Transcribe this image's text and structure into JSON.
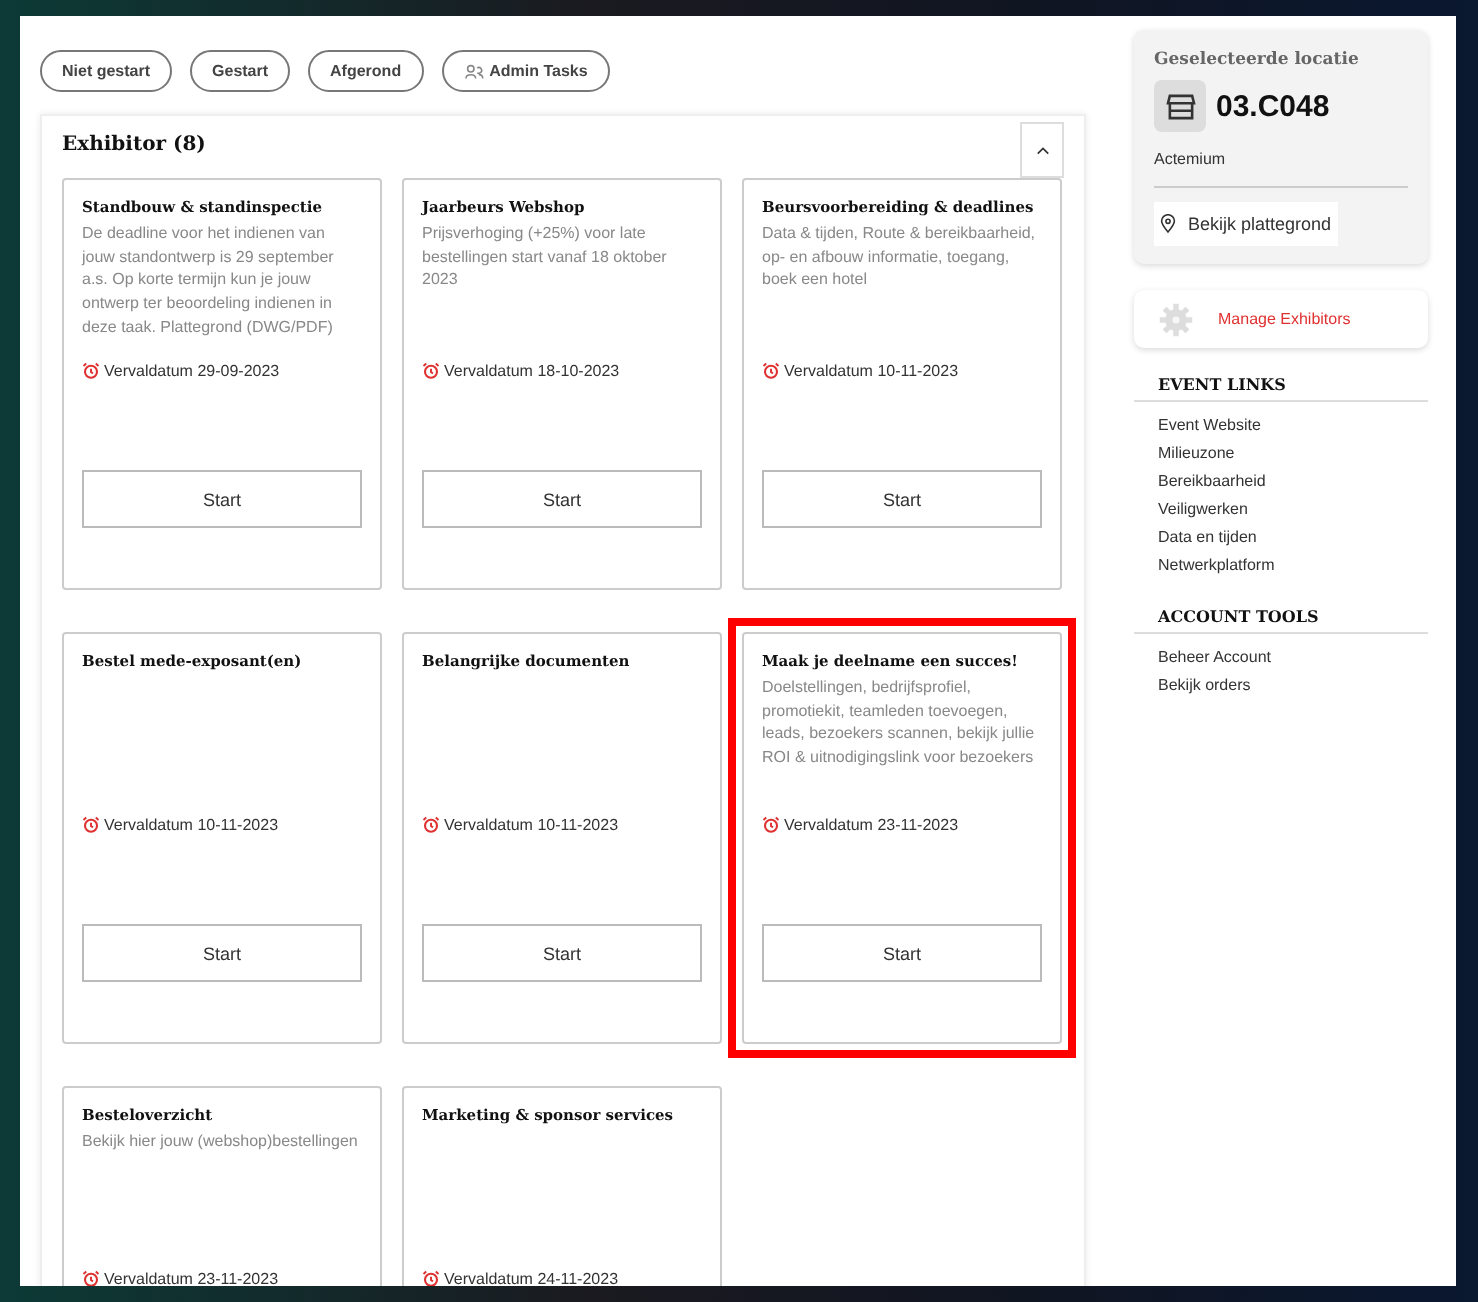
{
  "filters": [
    {
      "label": "Niet gestart",
      "icon": false
    },
    {
      "label": "Gestart",
      "icon": false
    },
    {
      "label": "Afgerond",
      "icon": false
    },
    {
      "label": "Admin Tasks",
      "icon": true
    }
  ],
  "section": {
    "title": "Exhibitor (8)",
    "expanded": true
  },
  "cards": [
    {
      "title": "Standbouw & standinspectie",
      "description": "De deadline voor het indienen van jouw standontwerp is 29 september a.s. Op korte termijn kun je jouw ontwerp ter beoordeling indienen in deze taak. Plattegrond (DWG/PDF)",
      "due": "Vervaldatum 29-09-2023",
      "button": "Start",
      "highlighted": false
    },
    {
      "title": "Jaarbeurs Webshop",
      "description": "Prijsverhoging (+25%) voor late bestellingen start vanaf 18 oktober 2023",
      "due": "Vervaldatum 18-10-2023",
      "button": "Start",
      "highlighted": false
    },
    {
      "title": "Beursvoorbereiding & deadlines",
      "description": "Data & tijden, Route & bereikbaarheid, op- en afbouw informatie, toegang, boek een hotel",
      "due": "Vervaldatum 10-11-2023",
      "button": "Start",
      "highlighted": false
    },
    {
      "title": "Bestel mede-exposant(en)",
      "due": "Vervaldatum 10-11-2023",
      "button": "Start",
      "highlighted": false
    },
    {
      "title": "Belangrijke documenten",
      "due": "Vervaldatum 10-11-2023",
      "button": "Start",
      "highlighted": false
    },
    {
      "title": "Maak je deelname een succes!",
      "description": "Doelstellingen, bedrijfsprofiel, promotiekit, teamleden toevoegen, leads, bezoekers scannen, bekijk jullie ROI & uitnodigingslink voor bezoekers",
      "due": "Vervaldatum 23-11-2023",
      "button": "Start",
      "highlighted": true
    },
    {
      "title": "Besteloverzicht",
      "description": "Bekijk hier jouw (webshop)bestellingen",
      "due": "Vervaldatum 23-11-2023",
      "highlighted": false
    },
    {
      "title": "Marketing & sponsor services",
      "due": "Vervaldatum 24-11-2023",
      "highlighted": false
    }
  ],
  "location": {
    "heading": "Geselecteerde locatie",
    "code": "03.C048",
    "company": "Actemium",
    "map_link": "Bekijk plattegrond"
  },
  "manage": {
    "label": "Manage Exhibitors"
  },
  "link_groups": [
    {
      "heading": "EVENT LINKS",
      "links": [
        "Event Website",
        "Milieuzone",
        "Bereikbaarheid",
        "Veiligwerken",
        "Data en tijden",
        "Netwerkplatform"
      ]
    },
    {
      "heading": "ACCOUNT TOOLS",
      "links": [
        "Beheer Account",
        "Bekijk orders"
      ]
    }
  ]
}
